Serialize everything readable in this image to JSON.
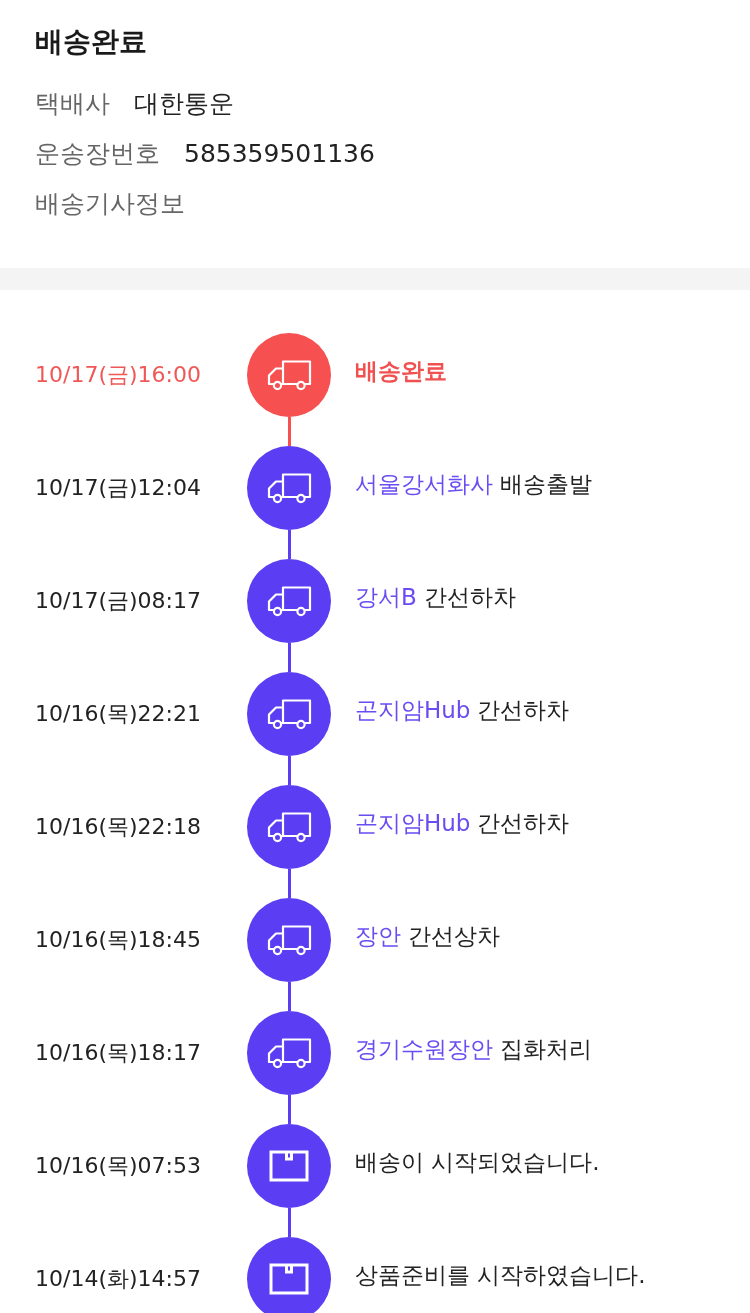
{
  "header": {
    "title": "배송완료",
    "fields": [
      {
        "label": "택배사",
        "value": "대한통운"
      },
      {
        "label": "운송장번호",
        "value": "585359501136"
      },
      {
        "label": "배송기사정보"
      }
    ]
  },
  "timeline": [
    {
      "time": "10/17(금)16:00",
      "kind": "transit",
      "latest": true,
      "text": "배송완료"
    },
    {
      "time": "10/17(금)12:04",
      "kind": "transit",
      "latest": false,
      "location": "서울강서화사",
      "text": "배송출발"
    },
    {
      "time": "10/17(금)08:17",
      "kind": "transit",
      "latest": false,
      "location": "강서B",
      "text": "간선하차"
    },
    {
      "time": "10/16(목)22:21",
      "kind": "transit",
      "latest": false,
      "location": "곤지암Hub",
      "text": "간선하차"
    },
    {
      "time": "10/16(목)22:18",
      "kind": "transit",
      "latest": false,
      "location": "곤지암Hub",
      "text": "간선하차"
    },
    {
      "time": "10/16(목)18:45",
      "kind": "transit",
      "latest": false,
      "location": "장안",
      "text": "간선상차"
    },
    {
      "time": "10/16(목)18:17",
      "kind": "transit",
      "latest": false,
      "location": "경기수원장안",
      "text": "집화처리"
    },
    {
      "time": "10/16(목)07:53",
      "kind": "order",
      "latest": false,
      "text": "배송이 시작되었습니다."
    },
    {
      "time": "10/14(화)14:57",
      "kind": "order",
      "latest": false,
      "text": "상품준비를 시작하였습니다."
    }
  ]
}
